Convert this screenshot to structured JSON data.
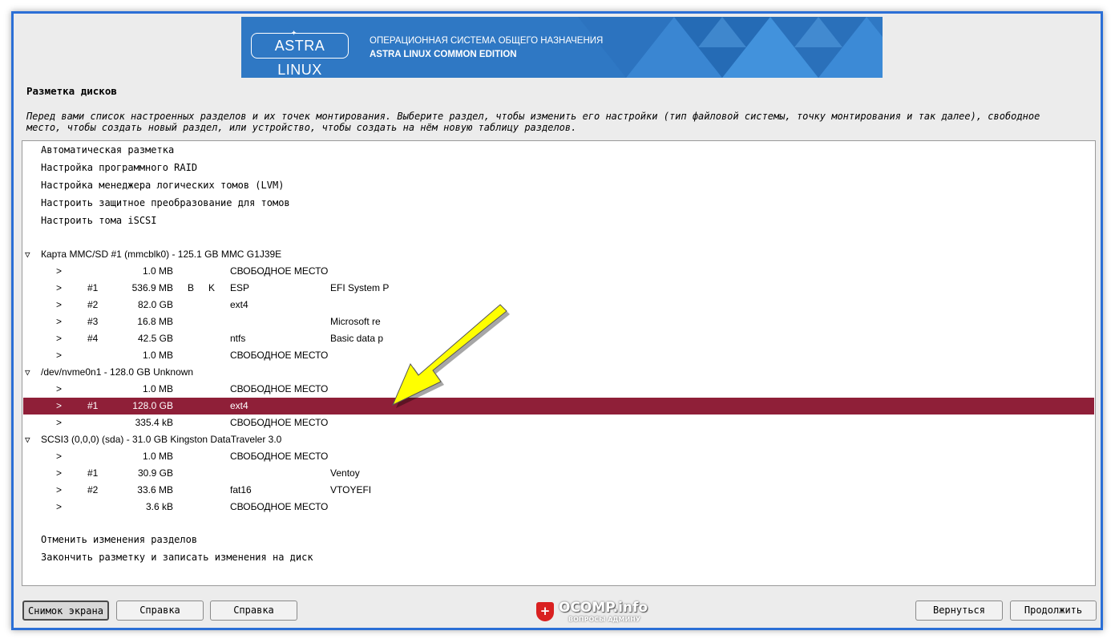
{
  "banner": {
    "logo": "ASTRA LINUX",
    "line1": "ОПЕРАЦИОННАЯ СИСТЕМА ОБЩЕГО НАЗНАЧЕНИЯ",
    "line2": "ASTRA LINUX COMMON EDITION"
  },
  "page_title": "Разметка дисков",
  "description": "Перед вами список настроенных разделов и их точек монтирования. Выберите раздел, чтобы изменить его настройки (тип файловой системы, точку монтирования и так далее), свободное место, чтобы создать новый раздел, или устройство, чтобы создать на нём новую таблицу разделов.",
  "menu_top": [
    "Автоматическая разметка",
    "Настройка программного RAID",
    "Настройка менеджера логических томов (LVM)",
    "Настроить защитное преобразование для томов",
    "Настроить тома iSCSI"
  ],
  "devices": [
    {
      "label": "Карта MMC/SD #1 (mmcblk0) - 125.1 GB MMC G1J39E",
      "rows": [
        {
          "arrow": ">",
          "num": "",
          "size": "1.0 MB",
          "flag1": "",
          "flag2": "",
          "fs": "СВОБОДНОЕ МЕСТО",
          "name": ""
        },
        {
          "arrow": ">",
          "num": "#1",
          "size": "536.9 MB",
          "flag1": "B",
          "flag2": "K",
          "fs": "ESP",
          "name": "EFI System P"
        },
        {
          "arrow": ">",
          "num": "#2",
          "size": "82.0 GB",
          "flag1": "",
          "flag2": "",
          "fs": "ext4",
          "name": ""
        },
        {
          "arrow": ">",
          "num": "#3",
          "size": "16.8 MB",
          "flag1": "",
          "flag2": "",
          "fs": "",
          "name": "Microsoft re"
        },
        {
          "arrow": ">",
          "num": "#4",
          "size": "42.5 GB",
          "flag1": "",
          "flag2": "",
          "fs": "ntfs",
          "name": "Basic data p"
        },
        {
          "arrow": ">",
          "num": "",
          "size": "1.0 MB",
          "flag1": "",
          "flag2": "",
          "fs": "СВОБОДНОЕ МЕСТО",
          "name": ""
        }
      ]
    },
    {
      "label": "/dev/nvme0n1 - 128.0 GB Unknown",
      "rows": [
        {
          "arrow": ">",
          "num": "",
          "size": "1.0 MB",
          "flag1": "",
          "flag2": "",
          "fs": "СВОБОДНОЕ МЕСТО",
          "name": ""
        },
        {
          "arrow": ">",
          "num": "#1",
          "size": "128.0 GB",
          "flag1": "",
          "flag2": "",
          "fs": "ext4",
          "name": "",
          "selected": true
        },
        {
          "arrow": ">",
          "num": "",
          "size": "335.4 kB",
          "flag1": "",
          "flag2": "",
          "fs": "СВОБОДНОЕ МЕСТО",
          "name": ""
        }
      ]
    },
    {
      "label": "SCSI3 (0,0,0) (sda) - 31.0 GB Kingston DataTraveler 3.0",
      "rows": [
        {
          "arrow": ">",
          "num": "",
          "size": "1.0 MB",
          "flag1": "",
          "flag2": "",
          "fs": "СВОБОДНОЕ МЕСТО",
          "name": ""
        },
        {
          "arrow": ">",
          "num": "#1",
          "size": "30.9 GB",
          "flag1": "",
          "flag2": "",
          "fs": "",
          "name": "Ventoy"
        },
        {
          "arrow": ">",
          "num": "#2",
          "size": "33.6 MB",
          "flag1": "",
          "flag2": "",
          "fs": "fat16",
          "name": "VTOYEFI"
        },
        {
          "arrow": ">",
          "num": "",
          "size": "3.6 kB",
          "flag1": "",
          "flag2": "",
          "fs": "СВОБОДНОЕ МЕСТО",
          "name": ""
        }
      ]
    }
  ],
  "menu_bottom": [
    "Отменить изменения разделов",
    "Закончить разметку и записать изменения на диск"
  ],
  "buttons": {
    "screenshot": "Снимок экрана",
    "help1": "Справка",
    "help2": "Справка",
    "back": "Вернуться",
    "continue": "Продолжить"
  },
  "watermark": {
    "title": "OCOMP.info",
    "subtitle": "ВОПРОСЫ АДМИНУ"
  },
  "colors": {
    "selected_row": "#8f1f38",
    "banner": "#2f78c4",
    "window_border": "#2b6fd6",
    "annotation_arrow": "#ffff00"
  }
}
